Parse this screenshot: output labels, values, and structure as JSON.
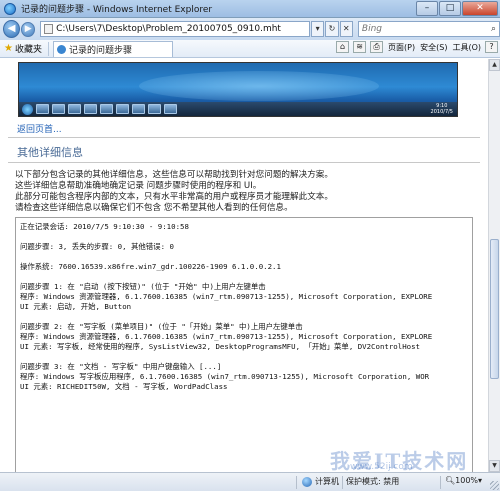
{
  "window": {
    "title": "记录的问题步骤 - Windows Internet Explorer"
  },
  "address_bar": {
    "url": "C:\\Users\\7\\Desktop\\Problem_20100705_0910.mht",
    "search_placeholder": "Bing"
  },
  "command_bar": {
    "favorites_label": "收藏夹",
    "tab_label": "记录的问题步骤",
    "tools": [
      {
        "label": "页面(P)"
      },
      {
        "label": "安全(S)"
      },
      {
        "label": "工具(O)"
      }
    ]
  },
  "embedded_screenshot": {
    "clock": [
      "9:10",
      "2010/7/5"
    ]
  },
  "content": {
    "back_link": "返回页首...",
    "section_title": "其他详细信息",
    "description_lines": [
      "以下部分包含记录的其他详细信息，这些信息可以帮助找到针对您问题的解决方案。",
      "这些详细信息帮助准确地确定记录 问题步骤时使用的程序和 UI。",
      "此部分可能包含程序内部的文本，只有水平非常高的用户或程序员才能理解此文本。",
      "请检查这些详细信息以确保它们不包含 您不希望其他人看到的任何信息。"
    ],
    "details": [
      "正在记录会话: 2010/7/5 9:10:30 - 9:10:58",
      "",
      "问题步骤: 3, 丢失的步骤: 0, 其他错误: 0",
      "",
      "操作系统: 7600.16539.x86fre.win7_gdr.100226-1909 6.1.0.0.2.1",
      "",
      "问题步骤 1: 在 \"启动 (按下按钮)\" (位于 \"开始\" 中)上用户左键单击",
      "程序: Windows 资源管理器, 6.1.7600.16385 (win7_rtm.090713-1255), Microsoft Corporation, EXPLORE",
      "UI 元素: 启动, 开始, Button",
      "",
      "问题步骤 2: 在 \"写字板 (菜单项目)\" (位于 \"「开始」菜单\" 中)上用户左键单击",
      "程序: Windows 资源管理器, 6.1.7600.16385 (win7_rtm.090713-1255), Microsoft Corporation, EXPLORE",
      "UI 元素: 写字板, 经常使用的程序, SysListView32, DesktopProgramsMFU, 「开始」菜单, DV2ControlHost",
      "",
      "问题步骤 3: 在 \"文档 - 写字板\" 中用户键盘输入 [...]",
      "程序: Windows 写字板应用程序, 6.1.7600.16385 (win7_rtm.090713-1255), Microsoft Corporation, WOR",
      "UI 元素: RICHEDIT50W, 文档 - 写字板, WordPadClass"
    ]
  },
  "status_bar": {
    "zone": "计算机",
    "protected_mode": "保护模式: 禁用",
    "zoom": "100%"
  },
  "watermark": {
    "text": "我爱IT技术网",
    "sub": "www.52ij.com"
  },
  "colors": {
    "link": "#1f5fb5",
    "section_title": "#4a6b96",
    "chrome_blue": "#b9d3ee"
  }
}
